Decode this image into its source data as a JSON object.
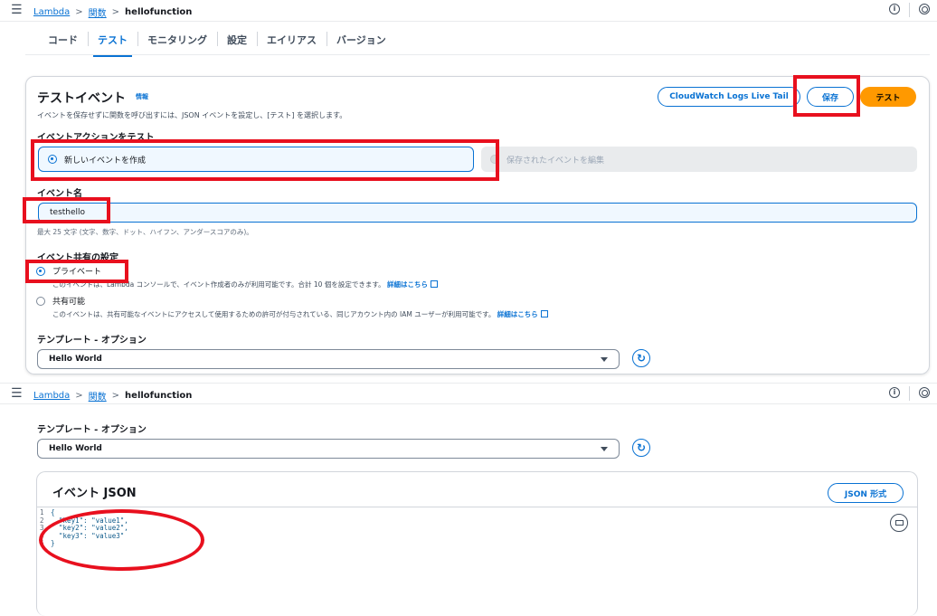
{
  "breadcrumb": {
    "root": "Lambda",
    "parent": "関数",
    "current": "hellofunction"
  },
  "tabs": [
    "コード",
    "テスト",
    "モニタリング",
    "設定",
    "エイリアス",
    "バージョン"
  ],
  "test_event": {
    "title": "テストイベント",
    "info": "情報",
    "description": "イベントを保存せずに関数を呼び出すには、JSON イベントを設定し、[テスト] を選択します。",
    "buttons": {
      "cloudwatch": "CloudWatch Logs Live Tail",
      "save": "保存",
      "test": "テスト"
    },
    "action_label": "イベントアクションをテスト",
    "action_new": "新しいイベントを作成",
    "action_edit": "保存されたイベントを編集",
    "name_label": "イベント名",
    "name_value": "testhello",
    "name_hint": "最大 25 文字 (文字、数字、ドット、ハイフン、アンダースコアのみ)。",
    "share_label": "イベント共有の設定",
    "private_label": "プライベート",
    "private_desc": "このイベントは、Lambda コンソールで、イベント作成者のみが利用可能です。合計 10 個を設定できます。",
    "shareable_label": "共有可能",
    "shareable_desc": "このイベントは、共有可能なイベントにアクセスして使用するための許可が付与されている、同じアカウント内の IAM ユーザーが利用可能です。",
    "learn_more": "詳細はこちら",
    "template_label": "テンプレート - オプション",
    "template_value": "Hello World"
  },
  "event_json": {
    "title": "イベント JSON",
    "format_button": "JSON 形式",
    "line_numbers": "1\n2\n3\n4\n5",
    "code": "{\n  \"key1\": \"value1\",\n  \"key2\": \"value2\",\n  \"key3\": \"value3\"\n}"
  },
  "colors": {
    "accent": "#0972d3",
    "primary_button": "#ff9900",
    "annotation": "#e8101e"
  }
}
